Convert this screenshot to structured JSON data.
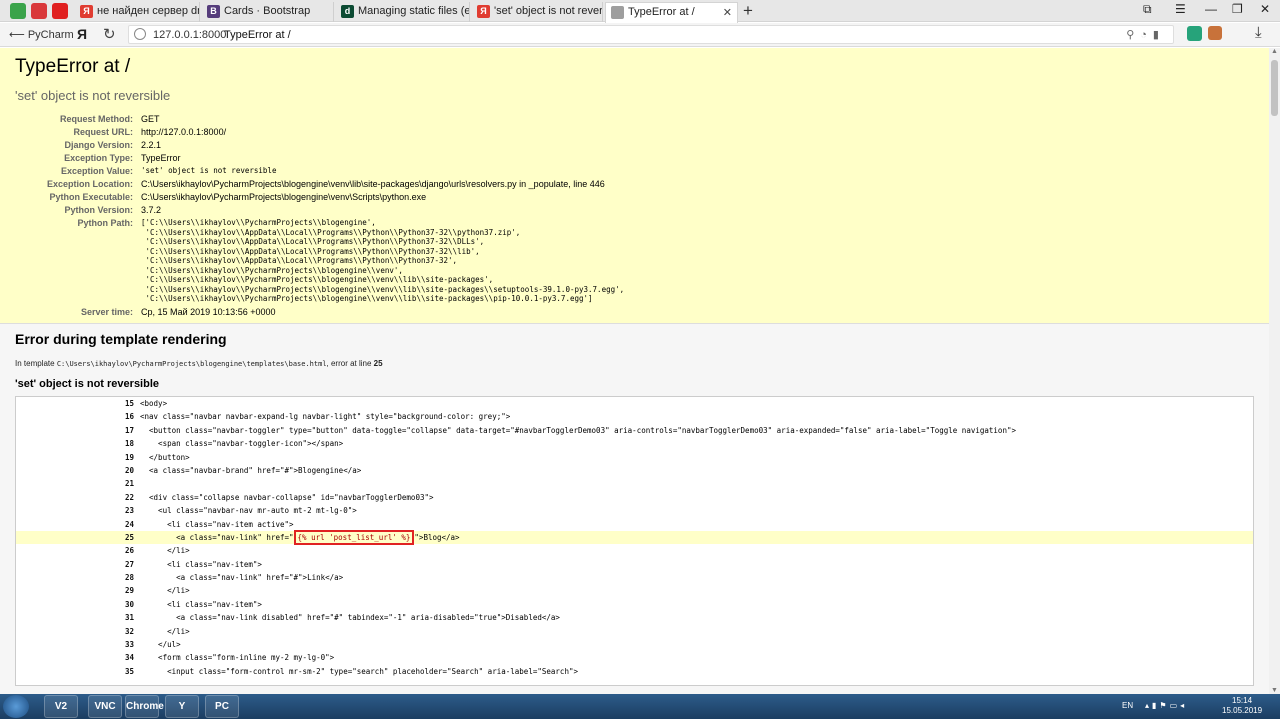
{
  "browser": {
    "tabs": [
      {
        "label": "не найден сервер dns на з",
        "color": "#e03c31",
        "glyph": "Я"
      },
      {
        "label": "Cards · Bootstrap",
        "color": "#563d7c",
        "glyph": "B"
      },
      {
        "label": "Managing static files (e.g. i",
        "color": "#0c4b33",
        "glyph": "d"
      },
      {
        "label": "'set' object is not reversible",
        "color": "#e03c31",
        "glyph": "Я"
      },
      {
        "label": "TypeError at /",
        "color": "#9e9e9e",
        "glyph": ""
      }
    ],
    "back_label": "PyCharm",
    "url_host": "127.0.0.1:8000",
    "page_title": "TypeError at /"
  },
  "error": {
    "title": "TypeError at /",
    "message": "'set' object is not reversible"
  },
  "meta": [
    {
      "key": "Request Method:",
      "value": "GET"
    },
    {
      "key": "Request URL:",
      "value": "http://127.0.0.1:8000/"
    },
    {
      "key": "Django Version:",
      "value": "2.2.1"
    },
    {
      "key": "Exception Type:",
      "value": "TypeError"
    },
    {
      "key": "Exception Value:",
      "value": "'set' object is not reversible",
      "mono": true
    },
    {
      "key": "Exception Location:",
      "value": "C:\\Users\\ikhaylov\\PycharmProjects\\blogengine\\venv\\lib\\site-packages\\django\\urls\\resolvers.py in _populate, line 446"
    },
    {
      "key": "Python Executable:",
      "value": "C:\\Users\\ikhaylov\\PycharmProjects\\blogengine\\venv\\Scripts\\python.exe"
    },
    {
      "key": "Python Version:",
      "value": "3.7.2"
    },
    {
      "key": "Python Path:",
      "value": "['C:\\\\Users\\\\ikhaylov\\\\PycharmProjects\\\\blogengine',\n 'C:\\\\Users\\\\ikhaylov\\\\AppData\\\\Local\\\\Programs\\\\Python\\\\Python37-32\\\\python37.zip',\n 'C:\\\\Users\\\\ikhaylov\\\\AppData\\\\Local\\\\Programs\\\\Python\\\\Python37-32\\\\DLLs',\n 'C:\\\\Users\\\\ikhaylov\\\\AppData\\\\Local\\\\Programs\\\\Python\\\\Python37-32\\\\lib',\n 'C:\\\\Users\\\\ikhaylov\\\\AppData\\\\Local\\\\Programs\\\\Python\\\\Python37-32',\n 'C:\\\\Users\\\\ikhaylov\\\\PycharmProjects\\\\blogengine\\\\venv',\n 'C:\\\\Users\\\\ikhaylov\\\\PycharmProjects\\\\blogengine\\\\venv\\\\lib\\\\site-packages',\n 'C:\\\\Users\\\\ikhaylov\\\\PycharmProjects\\\\blogengine\\\\venv\\\\lib\\\\site-packages\\\\setuptools-39.1.0-py3.7.egg',\n 'C:\\\\Users\\\\ikhaylov\\\\PycharmProjects\\\\blogengine\\\\venv\\\\lib\\\\site-packages\\\\pip-10.0.1-py3.7.egg']",
      "mono": true
    },
    {
      "key": "Server time:",
      "value": "Ср, 15 Май 2019 10:13:56 +0000"
    }
  ],
  "template": {
    "heading": "Error during template rendering",
    "intro_prefix": "In template",
    "path": "C:\\Users\\ikhaylov\\PycharmProjects\\blogengine\\templates\\base.html",
    "intro_mid": ", error at line",
    "error_line": "25",
    "error_message": "'set' object is not reversible",
    "source_lines": [
      {
        "ln": "15",
        "code": "<body>"
      },
      {
        "ln": "16",
        "code": "<nav class=\"navbar navbar-expand-lg navbar-light\" style=\"background-color: grey;\">"
      },
      {
        "ln": "17",
        "code": "  <button class=\"navbar-toggler\" type=\"button\" data-toggle=\"collapse\" data-target=\"#navbarTogglerDemo03\" aria-controls=\"navbarTogglerDemo03\" aria-expanded=\"false\" aria-label=\"Toggle navigation\">"
      },
      {
        "ln": "18",
        "code": "    <span class=\"navbar-toggler-icon\"></span>"
      },
      {
        "ln": "19",
        "code": "  </button>"
      },
      {
        "ln": "20",
        "code": "  <a class=\"navbar-brand\" href=\"#\">Blogengine</a>"
      },
      {
        "ln": "21",
        "code": ""
      },
      {
        "ln": "22",
        "code": "  <div class=\"collapse navbar-collapse\" id=\"navbarTogglerDemo03\">"
      },
      {
        "ln": "23",
        "code": "    <ul class=\"navbar-nav mr-auto mt-2 mt-lg-0\">"
      },
      {
        "ln": "24",
        "code": "      <li class=\"nav-item active\">"
      },
      {
        "ln": "25",
        "pre": "        <a class=\"nav-link\" href=\"",
        "err": "{% url 'post_list_url' %}",
        "post": "\">Blog</a>",
        "highlight": true
      },
      {
        "ln": "26",
        "code": "      </li>"
      },
      {
        "ln": "27",
        "code": "      <li class=\"nav-item\">"
      },
      {
        "ln": "28",
        "code": "        <a class=\"nav-link\" href=\"#\">Link</a>"
      },
      {
        "ln": "29",
        "code": "      </li>"
      },
      {
        "ln": "30",
        "code": "      <li class=\"nav-item\">"
      },
      {
        "ln": "31",
        "code": "        <a class=\"nav-link disabled\" href=\"#\" tabindex=\"-1\" aria-disabled=\"true\">Disabled</a>"
      },
      {
        "ln": "32",
        "code": "      </li>"
      },
      {
        "ln": "33",
        "code": "    </ul>"
      },
      {
        "ln": "34",
        "code": "    <form class=\"form-inline my-2 my-lg-0\">"
      },
      {
        "ln": "35",
        "code": "      <input class=\"form-control mr-sm-2\" type=\"search\" placeholder=\"Search\" aria-label=\"Search\">"
      }
    ]
  },
  "taskbar": {
    "lang": "EN",
    "time": "15:14",
    "date": "15.05.2019",
    "apps": [
      "V2",
      "VNC",
      "Chrome",
      "Y",
      "PC"
    ]
  },
  "colors": {
    "summary_bg": "#ffffc8",
    "error_box": "#e02222"
  }
}
